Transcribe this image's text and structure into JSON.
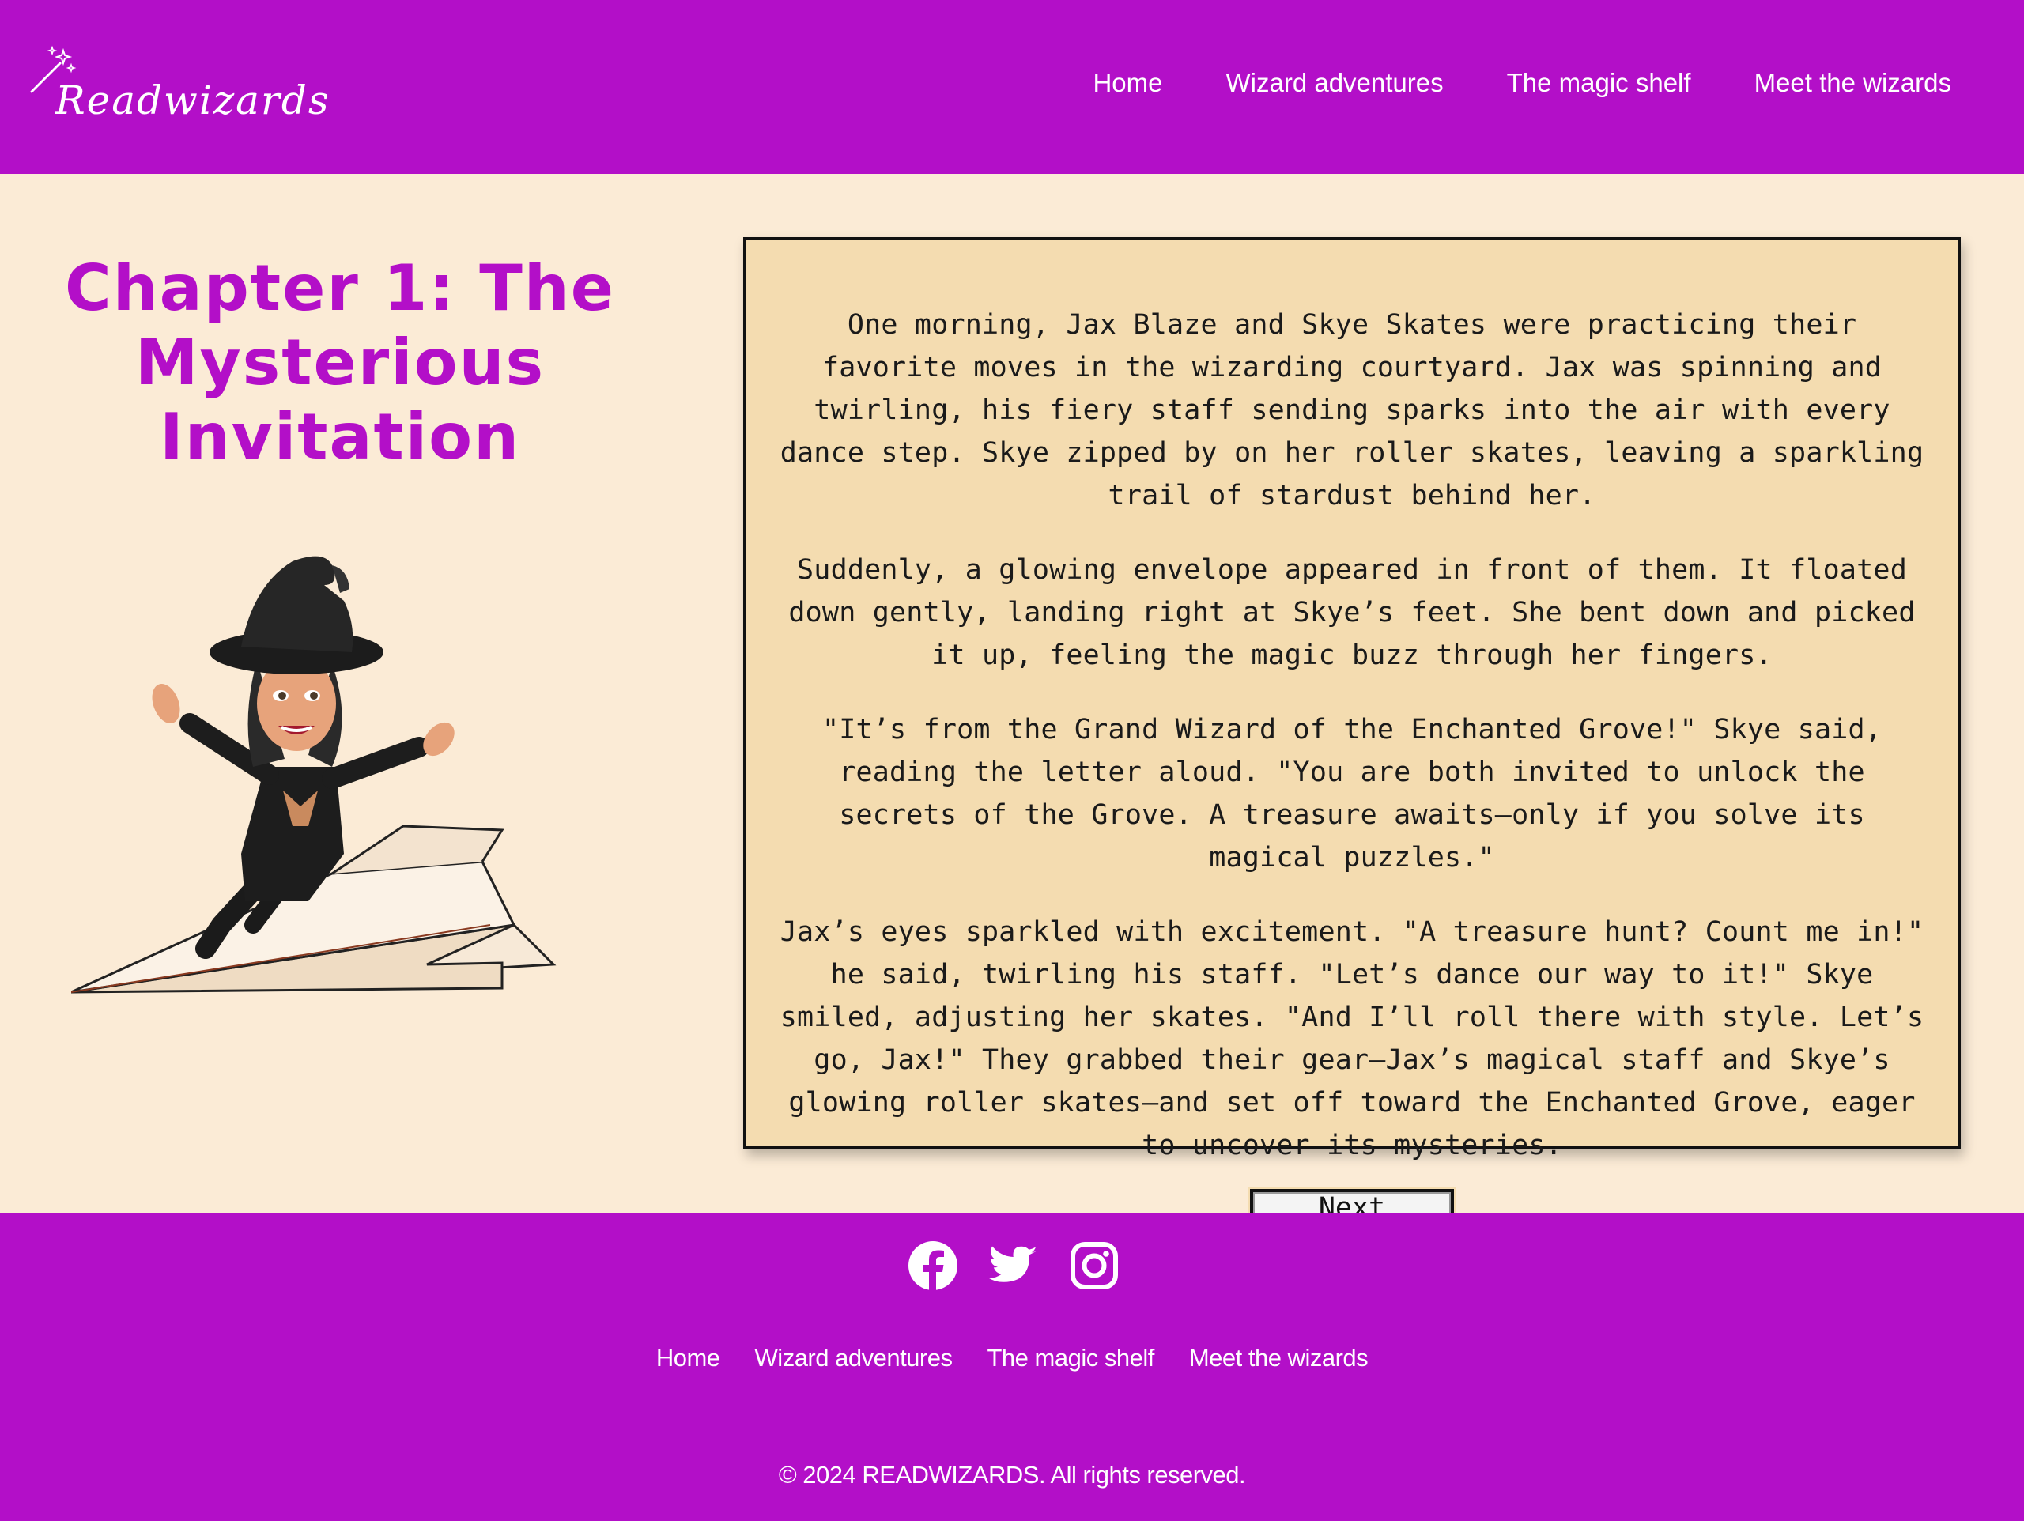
{
  "header": {
    "brand": "Readwizards",
    "nav": [
      "Home",
      "Wizard adventures",
      "The magic shelf",
      "Meet the wizards"
    ]
  },
  "chapter": {
    "title": "Chapter 1: The Mysterious Invitation",
    "paragraphs": [
      "One morning, Jax Blaze and Skye Skates were practicing their favorite moves in the wizarding courtyard. Jax was spinning and twirling, his fiery staff sending sparks into the air with every dance step. Skye zipped by on her roller skates, leaving a sparkling trail of stardust behind her.",
      "Suddenly, a glowing envelope appeared in front of them. It floated down gently, landing right at Skye’s feet. She bent down and picked it up, feeling the magic buzz through her fingers.",
      "\"It’s from the Grand Wizard of the Enchanted Grove!\" Skye said, reading the letter aloud. \"You are both invited to unlock the secrets of the Grove. A treasure awaits—only if you solve its magical puzzles.\"",
      "Jax’s eyes sparkled with excitement. \"A treasure hunt? Count me in!\" he said, twirling his staff. \"Let’s dance our way to it!\" Skye smiled, adjusting her skates. \"And I’ll roll there with style. Let’s go, Jax!\" They grabbed their gear—Jax’s magical staff and Skye’s glowing roller skates—and set off toward the Enchanted Grove, eager to uncover its mysteries."
    ],
    "next_button": "Next Chapter"
  },
  "footer": {
    "social": [
      "facebook-icon",
      "twitter-icon",
      "instagram-icon"
    ],
    "nav": [
      "Home",
      "Wizard adventures",
      "The magic shelf",
      "Meet the wizards"
    ],
    "copyright": "© 2024 READWIZARDS. All rights reserved."
  },
  "colors": {
    "brand_purple": "#b30fc8",
    "page_bg": "#fbebd6",
    "panel_bg": "#f4dcb0"
  }
}
